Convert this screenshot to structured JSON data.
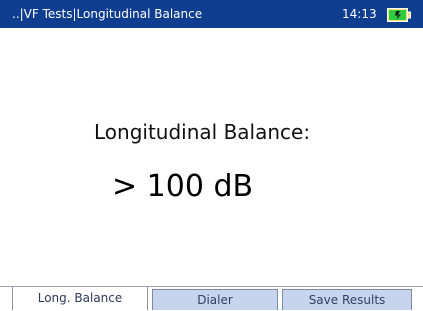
{
  "titlebar": {
    "title": "..|VF Tests|Longitudinal Balance",
    "time": "14:13",
    "battery_icon": "battery-charging-icon"
  },
  "main": {
    "label": "Longitudinal Balance:",
    "value": "> 100 dB"
  },
  "tabs": [
    {
      "label": "Long. Balance",
      "active": true
    },
    {
      "label": "Dialer",
      "active": false
    },
    {
      "label": "Save Results",
      "active": false
    }
  ],
  "colors": {
    "titlebar_bg": "#0f3d8f",
    "tab_inactive_bg": "#c7d4ee",
    "battery_fill": "#2ecc40"
  }
}
